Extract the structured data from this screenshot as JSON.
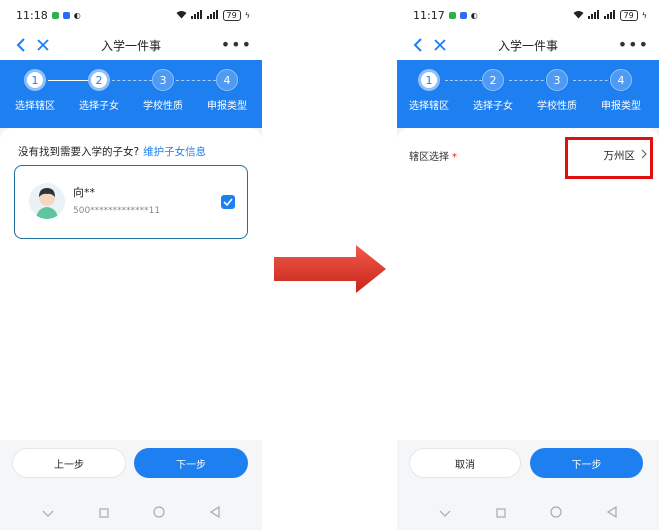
{
  "left": {
    "status_time": "11:18",
    "battery": "79",
    "nav_title": "入学一件事",
    "steps": [
      {
        "num": "1",
        "label": "选择辖区"
      },
      {
        "num": "2",
        "label": "选择子女"
      },
      {
        "num": "3",
        "label": "学校性质"
      },
      {
        "num": "4",
        "label": "申报类型"
      }
    ],
    "prompt_text": "没有找到需要入学的子女?",
    "prompt_link": "维护子女信息",
    "child_name": "向**",
    "child_id": "500*************11",
    "prev_button": "上一步",
    "next_button": "下一步"
  },
  "right": {
    "status_time": "11:17",
    "battery": "79",
    "nav_title": "入学一件事",
    "steps": [
      {
        "num": "1",
        "label": "选择辖区"
      },
      {
        "num": "2",
        "label": "选择子女"
      },
      {
        "num": "3",
        "label": "学校性质"
      },
      {
        "num": "4",
        "label": "申报类型"
      }
    ],
    "district_label": "辖区选择",
    "required_mark": "*",
    "district_value": "万州区",
    "cancel_button": "取消",
    "next_button": "下一步"
  },
  "colors": {
    "primary_blue": "#1e7ff0",
    "highlight_red": "#e01010",
    "arrow_red": "#d93025"
  }
}
